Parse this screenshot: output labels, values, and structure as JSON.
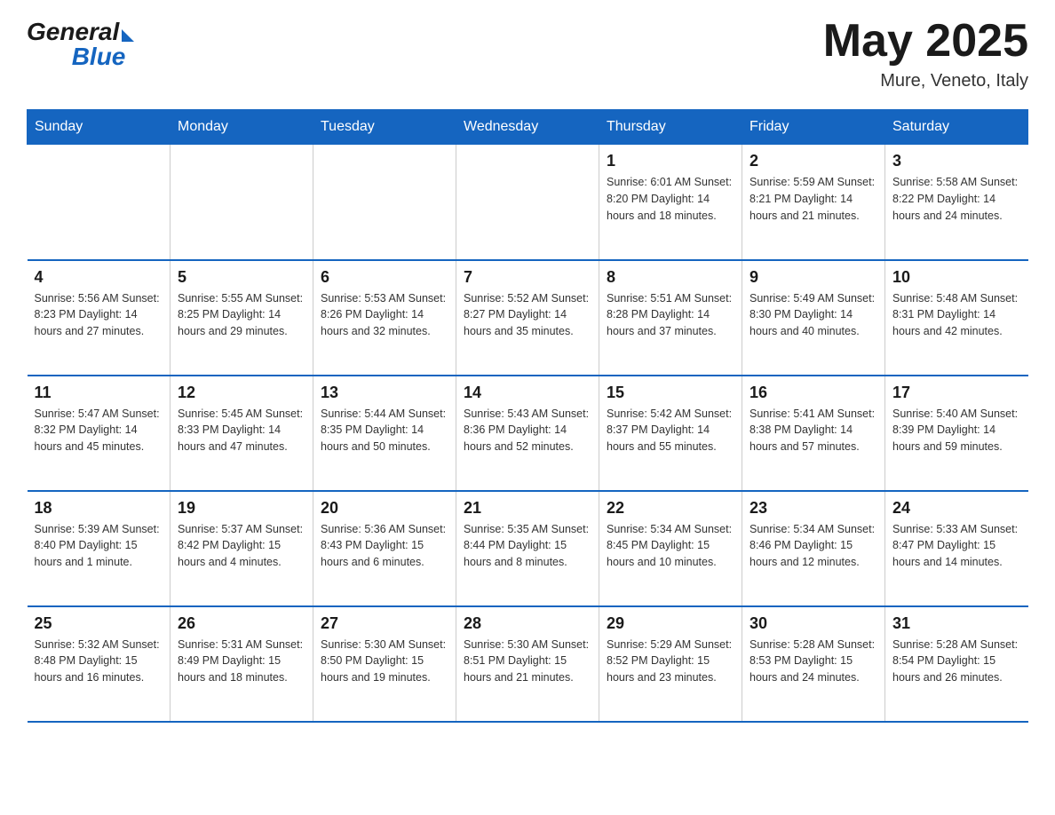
{
  "logo": {
    "general": "General",
    "blue": "Blue"
  },
  "title": {
    "month_year": "May 2025",
    "location": "Mure, Veneto, Italy"
  },
  "days_of_week": [
    "Sunday",
    "Monday",
    "Tuesday",
    "Wednesday",
    "Thursday",
    "Friday",
    "Saturday"
  ],
  "weeks": [
    [
      {
        "day": "",
        "info": ""
      },
      {
        "day": "",
        "info": ""
      },
      {
        "day": "",
        "info": ""
      },
      {
        "day": "",
        "info": ""
      },
      {
        "day": "1",
        "info": "Sunrise: 6:01 AM\nSunset: 8:20 PM\nDaylight: 14 hours\nand 18 minutes."
      },
      {
        "day": "2",
        "info": "Sunrise: 5:59 AM\nSunset: 8:21 PM\nDaylight: 14 hours\nand 21 minutes."
      },
      {
        "day": "3",
        "info": "Sunrise: 5:58 AM\nSunset: 8:22 PM\nDaylight: 14 hours\nand 24 minutes."
      }
    ],
    [
      {
        "day": "4",
        "info": "Sunrise: 5:56 AM\nSunset: 8:23 PM\nDaylight: 14 hours\nand 27 minutes."
      },
      {
        "day": "5",
        "info": "Sunrise: 5:55 AM\nSunset: 8:25 PM\nDaylight: 14 hours\nand 29 minutes."
      },
      {
        "day": "6",
        "info": "Sunrise: 5:53 AM\nSunset: 8:26 PM\nDaylight: 14 hours\nand 32 minutes."
      },
      {
        "day": "7",
        "info": "Sunrise: 5:52 AM\nSunset: 8:27 PM\nDaylight: 14 hours\nand 35 minutes."
      },
      {
        "day": "8",
        "info": "Sunrise: 5:51 AM\nSunset: 8:28 PM\nDaylight: 14 hours\nand 37 minutes."
      },
      {
        "day": "9",
        "info": "Sunrise: 5:49 AM\nSunset: 8:30 PM\nDaylight: 14 hours\nand 40 minutes."
      },
      {
        "day": "10",
        "info": "Sunrise: 5:48 AM\nSunset: 8:31 PM\nDaylight: 14 hours\nand 42 minutes."
      }
    ],
    [
      {
        "day": "11",
        "info": "Sunrise: 5:47 AM\nSunset: 8:32 PM\nDaylight: 14 hours\nand 45 minutes."
      },
      {
        "day": "12",
        "info": "Sunrise: 5:45 AM\nSunset: 8:33 PM\nDaylight: 14 hours\nand 47 minutes."
      },
      {
        "day": "13",
        "info": "Sunrise: 5:44 AM\nSunset: 8:35 PM\nDaylight: 14 hours\nand 50 minutes."
      },
      {
        "day": "14",
        "info": "Sunrise: 5:43 AM\nSunset: 8:36 PM\nDaylight: 14 hours\nand 52 minutes."
      },
      {
        "day": "15",
        "info": "Sunrise: 5:42 AM\nSunset: 8:37 PM\nDaylight: 14 hours\nand 55 minutes."
      },
      {
        "day": "16",
        "info": "Sunrise: 5:41 AM\nSunset: 8:38 PM\nDaylight: 14 hours\nand 57 minutes."
      },
      {
        "day": "17",
        "info": "Sunrise: 5:40 AM\nSunset: 8:39 PM\nDaylight: 14 hours\nand 59 minutes."
      }
    ],
    [
      {
        "day": "18",
        "info": "Sunrise: 5:39 AM\nSunset: 8:40 PM\nDaylight: 15 hours\nand 1 minute."
      },
      {
        "day": "19",
        "info": "Sunrise: 5:37 AM\nSunset: 8:42 PM\nDaylight: 15 hours\nand 4 minutes."
      },
      {
        "day": "20",
        "info": "Sunrise: 5:36 AM\nSunset: 8:43 PM\nDaylight: 15 hours\nand 6 minutes."
      },
      {
        "day": "21",
        "info": "Sunrise: 5:35 AM\nSunset: 8:44 PM\nDaylight: 15 hours\nand 8 minutes."
      },
      {
        "day": "22",
        "info": "Sunrise: 5:34 AM\nSunset: 8:45 PM\nDaylight: 15 hours\nand 10 minutes."
      },
      {
        "day": "23",
        "info": "Sunrise: 5:34 AM\nSunset: 8:46 PM\nDaylight: 15 hours\nand 12 minutes."
      },
      {
        "day": "24",
        "info": "Sunrise: 5:33 AM\nSunset: 8:47 PM\nDaylight: 15 hours\nand 14 minutes."
      }
    ],
    [
      {
        "day": "25",
        "info": "Sunrise: 5:32 AM\nSunset: 8:48 PM\nDaylight: 15 hours\nand 16 minutes."
      },
      {
        "day": "26",
        "info": "Sunrise: 5:31 AM\nSunset: 8:49 PM\nDaylight: 15 hours\nand 18 minutes."
      },
      {
        "day": "27",
        "info": "Sunrise: 5:30 AM\nSunset: 8:50 PM\nDaylight: 15 hours\nand 19 minutes."
      },
      {
        "day": "28",
        "info": "Sunrise: 5:30 AM\nSunset: 8:51 PM\nDaylight: 15 hours\nand 21 minutes."
      },
      {
        "day": "29",
        "info": "Sunrise: 5:29 AM\nSunset: 8:52 PM\nDaylight: 15 hours\nand 23 minutes."
      },
      {
        "day": "30",
        "info": "Sunrise: 5:28 AM\nSunset: 8:53 PM\nDaylight: 15 hours\nand 24 minutes."
      },
      {
        "day": "31",
        "info": "Sunrise: 5:28 AM\nSunset: 8:54 PM\nDaylight: 15 hours\nand 26 minutes."
      }
    ]
  ]
}
